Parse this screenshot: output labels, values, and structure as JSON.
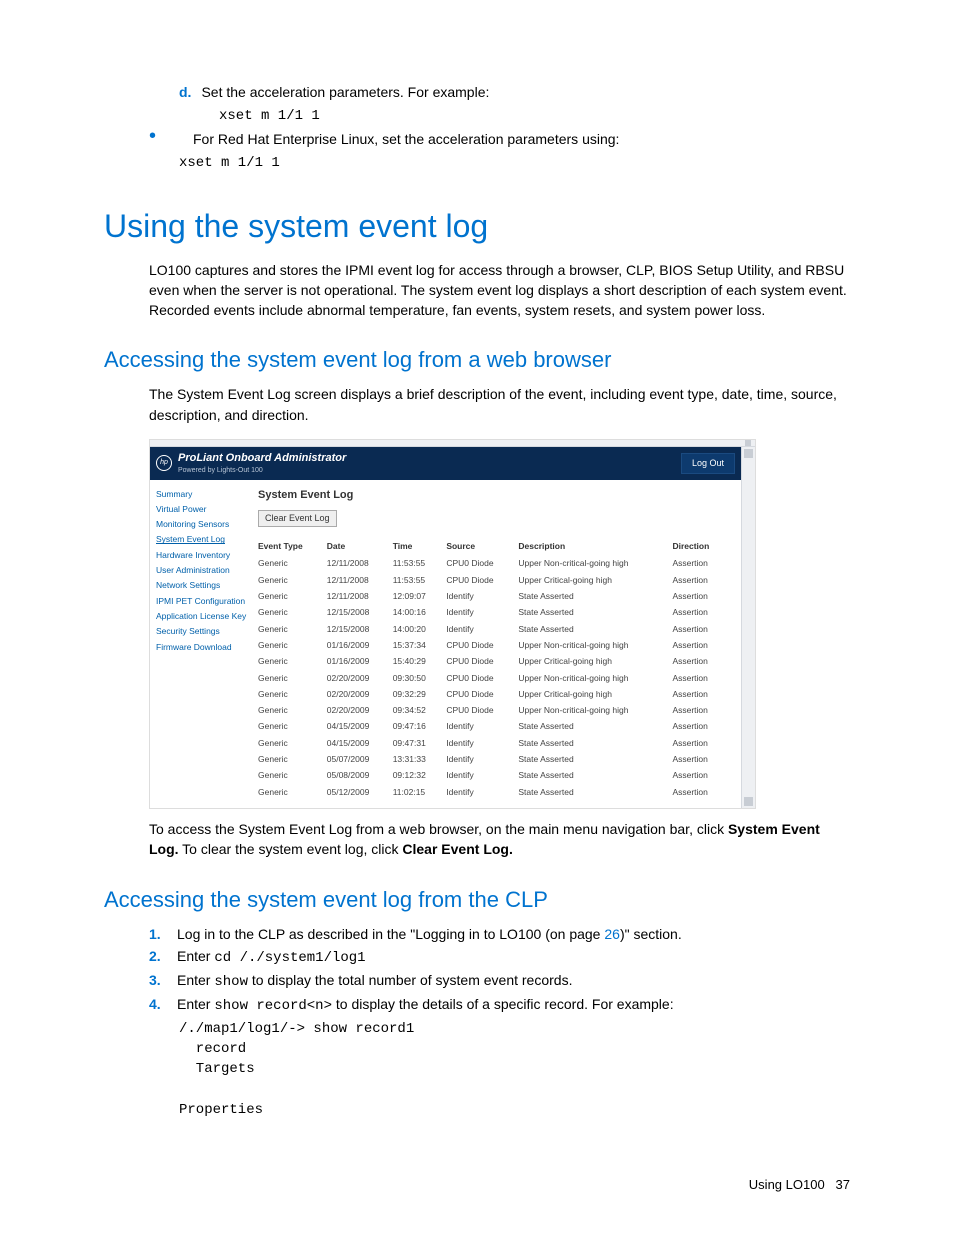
{
  "intro": {
    "step_d_label": "d.",
    "step_d_text": "Set the acceleration parameters. For example:",
    "step_d_code": "xset m 1/1 1",
    "bullet_text": "For Red Hat Enterprise Linux, set the acceleration parameters using:",
    "bullet_code": "xset m 1/1 1"
  },
  "h1": "Using the system event log",
  "p1": "LO100 captures and stores the IPMI event log for access through a browser, CLP, BIOS Setup Utility, and RBSU even when the server is not operational. The system event log displays a short description of each system event. Recorded events include abnormal temperature, fan events, system resets, and system power loss.",
  "h2a": "Accessing the system event log from a web browser",
  "p2": "The System Event Log screen displays a brief description of the event, including event type, date, time, source, description, and direction.",
  "screenshot": {
    "brand": "ProLiant Onboard Administrator",
    "sub": "Powered by Lights-Out 100",
    "logo": "hp",
    "logout": "Log Out",
    "nav": [
      "Summary",
      "Virtual Power",
      "Monitoring Sensors",
      "System Event Log",
      "Hardware Inventory",
      "User Administration",
      "Network Settings",
      "IPMI PET Configuration",
      "Application License Key",
      "Security Settings",
      "Firmware Download"
    ],
    "nav_active_index": 3,
    "title": "System Event Log",
    "clear_btn": "Clear Event Log",
    "headers": [
      "Event Type",
      "Date",
      "Time",
      "Source",
      "Description",
      "Direction"
    ],
    "rows": [
      [
        "Generic",
        "12/11/2008",
        "11:53:55",
        "CPU0 Diode",
        "Upper Non-critical-going high",
        "Assertion"
      ],
      [
        "Generic",
        "12/11/2008",
        "11:53:55",
        "CPU0 Diode",
        "Upper Critical-going high",
        "Assertion"
      ],
      [
        "Generic",
        "12/11/2008",
        "12:09:07",
        "Identify",
        "State Asserted",
        "Assertion"
      ],
      [
        "Generic",
        "12/15/2008",
        "14:00:16",
        "Identify",
        "State Asserted",
        "Assertion"
      ],
      [
        "Generic",
        "12/15/2008",
        "14:00:20",
        "Identify",
        "State Asserted",
        "Assertion"
      ],
      [
        "Generic",
        "01/16/2009",
        "15:37:34",
        "CPU0 Diode",
        "Upper Non-critical-going high",
        "Assertion"
      ],
      [
        "Generic",
        "01/16/2009",
        "15:40:29",
        "CPU0 Diode",
        "Upper Critical-going high",
        "Assertion"
      ],
      [
        "Generic",
        "02/20/2009",
        "09:30:50",
        "CPU0 Diode",
        "Upper Non-critical-going high",
        "Assertion"
      ],
      [
        "Generic",
        "02/20/2009",
        "09:32:29",
        "CPU0 Diode",
        "Upper Critical-going high",
        "Assertion"
      ],
      [
        "Generic",
        "02/20/2009",
        "09:34:52",
        "CPU0 Diode",
        "Upper Non-critical-going high",
        "Assertion"
      ],
      [
        "Generic",
        "04/15/2009",
        "09:47:16",
        "Identify",
        "State Asserted",
        "Assertion"
      ],
      [
        "Generic",
        "04/15/2009",
        "09:47:31",
        "Identify",
        "State Asserted",
        "Assertion"
      ],
      [
        "Generic",
        "05/07/2009",
        "13:31:33",
        "Identify",
        "State Asserted",
        "Assertion"
      ],
      [
        "Generic",
        "05/08/2009",
        "09:12:32",
        "Identify",
        "State Asserted",
        "Assertion"
      ],
      [
        "Generic",
        "05/12/2009",
        "11:02:15",
        "Identify",
        "State Asserted",
        "Assertion"
      ]
    ]
  },
  "p3a": "To access the System Event Log from a web browser, on the main menu navigation bar, click ",
  "p3b": "System Event Log.",
  "p3c": " To clear the system event log, click ",
  "p3d": "Clear Event Log.",
  "h2b": "Accessing the system event log from the CLP",
  "clp": {
    "s1a": "Log in to the CLP as described in the \"Logging in to LO100 (on page ",
    "s1link": "26",
    "s1b": ")\" section.",
    "s2a": "Enter ",
    "s2code": "cd /./system1/log1",
    "s3a": "Enter ",
    "s3code": "show",
    "s3b": " to display the total number of system event records.",
    "s4a": "Enter ",
    "s4code": "show record<n>",
    "s4b": " to display the details of a specific record. For example:",
    "pre": "/./map1/log1/-> show record1\n  record\n  Targets\n\nProperties"
  },
  "footer": {
    "text": "Using LO100",
    "page": "37"
  }
}
